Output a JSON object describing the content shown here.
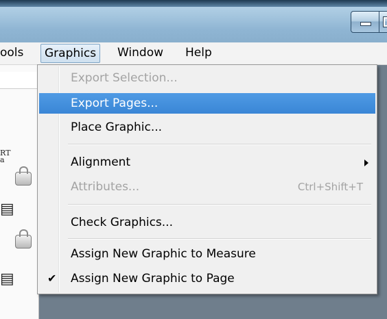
{
  "window": {
    "minimize_icon": "minimize-icon",
    "maximize_icon": "maximize-icon"
  },
  "menubar": {
    "tools": "ools",
    "graphics": "Graphics",
    "window": "Window",
    "help": "Help"
  },
  "document": {
    "fragment_text_1": "RT",
    "fragment_text_2": "a"
  },
  "graphics_menu": {
    "items": [
      {
        "label": "Export Selection...",
        "enabled": false
      },
      {
        "label": "Export Pages...",
        "enabled": true,
        "highlighted": true
      },
      {
        "label": "Place Graphic...",
        "enabled": true
      },
      {
        "label": "Alignment",
        "enabled": true,
        "submenu": true
      },
      {
        "label": "Attributes...",
        "enabled": false,
        "shortcut": "Ctrl+Shift+T"
      },
      {
        "label": "Check Graphics...",
        "enabled": true
      },
      {
        "label": "Assign New Graphic to Measure",
        "enabled": true
      },
      {
        "label": "Assign New Graphic to Page",
        "enabled": true,
        "checked": true
      }
    ]
  },
  "colors": {
    "highlight": "#3a86d6",
    "disabled_text": "#a3a3a3",
    "menu_bg": "#f0f0f0"
  }
}
